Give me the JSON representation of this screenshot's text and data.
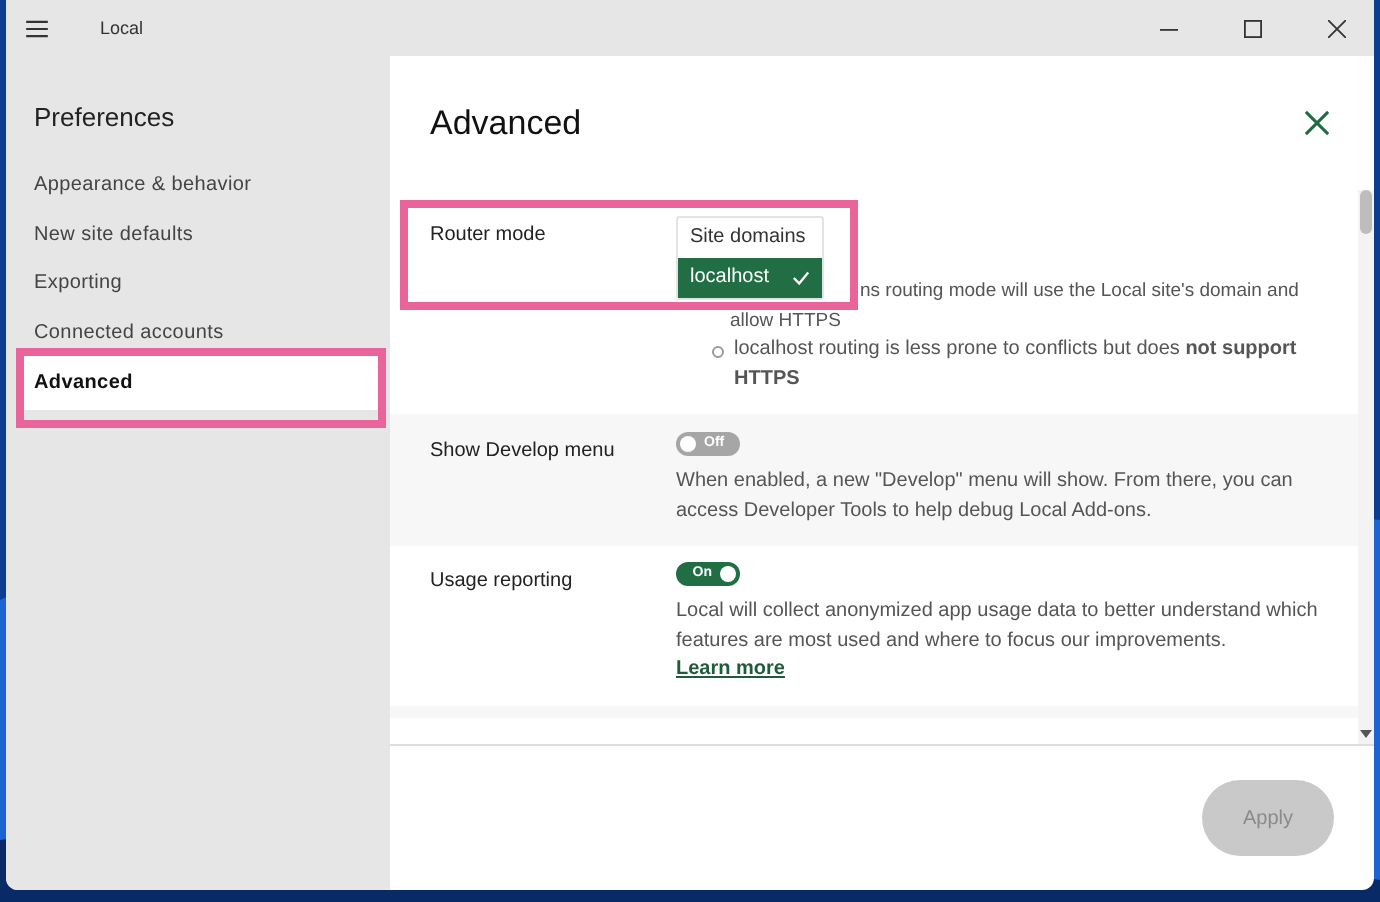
{
  "window": {
    "title": "Local"
  },
  "sidebar": {
    "title": "Preferences",
    "items": [
      {
        "label": "Appearance & behavior",
        "selected": false
      },
      {
        "label": "New site defaults",
        "selected": false
      },
      {
        "label": "Exporting",
        "selected": false
      },
      {
        "label": "Connected accounts",
        "selected": false
      },
      {
        "label": "Advanced",
        "selected": true
      }
    ]
  },
  "panel": {
    "title": "Advanced"
  },
  "settings": [
    {
      "kind": "select",
      "label": "Router mode",
      "options": [
        {
          "label": "Site domains",
          "selected": false
        },
        {
          "label": "localhost",
          "selected": true
        }
      ],
      "notes": [
        {
          "lines": [
            "ns routing mode will use the Local site's domain and",
            "allow HTTPS"
          ]
        },
        {
          "text": "localhost routing is less prone to conflicts but does **not support HTTPS**"
        }
      ]
    },
    {
      "kind": "toggle",
      "label": "Show Develop menu",
      "on": false,
      "toggle_text": "Off",
      "description": "When enabled, a new \"Develop\" menu will show. From there, you can access Developer Tools to help debug Local Add-ons."
    },
    {
      "kind": "toggle",
      "label": "Usage reporting",
      "on": true,
      "toggle_text": "On",
      "description": "Local will collect anonymized app usage data to better understand which features are most used and where to focus our improvements.",
      "link": "Learn more"
    }
  ],
  "footer": {
    "button": {
      "label": "Apply",
      "disabled": true
    }
  }
}
